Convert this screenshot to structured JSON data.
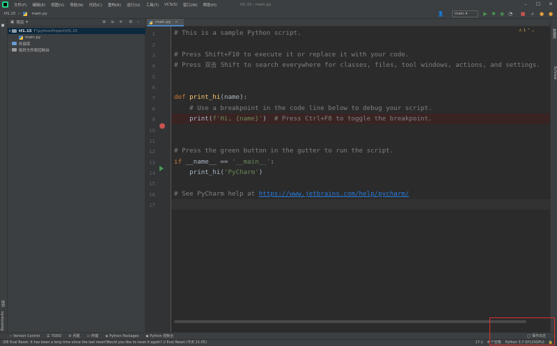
{
  "window": {
    "title": "tf1.15 - main.py"
  },
  "menu": [
    "文件(F)",
    "编辑(E)",
    "视图(V)",
    "导航(N)",
    "代码(C)",
    "重构(R)",
    "运行(U)",
    "工具(T)",
    "VCS(S)",
    "窗口(W)",
    "帮助(H)"
  ],
  "breadcrumb": {
    "project": "tf1.15",
    "file": "main.py"
  },
  "toolbar": {
    "run_config": "main"
  },
  "project_panel": {
    "title": "项目",
    "root_name": "tf1.15",
    "root_path": "F:\\pythonProject\\tf1.15",
    "file": "main.py",
    "external_libs": "外部库",
    "scratches": "临时文件和控制台"
  },
  "editor": {
    "tab": "main.py",
    "inspections": "1",
    "lines": [
      "1",
      "2",
      "3",
      "4",
      "5",
      "6",
      "7",
      "8",
      "9",
      "10",
      "11",
      "12",
      "13",
      "14",
      "15",
      "16",
      "17"
    ],
    "code": {
      "l1": "# This is a sample Python script.",
      "l3": "# Press Shift+F10 to execute it or replace it with your code.",
      "l4a": "# Press ",
      "l4b": "双击",
      "l4c": " Shift to search everywhere for classes, files, tool windows, actions, and settings.",
      "l7_kw": "def ",
      "l7_fn": "print_hi",
      "l7_rest": "(name):",
      "l8": "    # Use a breakpoint in the code line below to debug your script.",
      "l9_a": "    print(",
      "l9_str": "f'Hi, {name}'",
      "l9_b": ")  ",
      "l9_cmt": "# Press Ctrl+F8 to toggle the breakpoint.",
      "l12": "# Press the green button in the gutter to run the script.",
      "l13_kw": "if ",
      "l13_a": "__name__ == ",
      "l13_str": "'__main__'",
      "l13_b": ":",
      "l14_a": "    print_hi(",
      "l14_str": "'PyCharm'",
      "l14_b": ")",
      "l16_cmt": "# See PyCharm help at ",
      "l16_url": "https://www.jetbrains.com/help/pycharm/"
    }
  },
  "left_stripe": {
    "structure": "结构",
    "bookmarks": "Bookmarks"
  },
  "right_stripe": {
    "database": "数据库",
    "sciview": "SciView"
  },
  "tool_windows": [
    "Version Control",
    "TODO",
    "问题",
    "终端",
    "Python Packages",
    "Python 控制台"
  ],
  "event_log": "事件日志",
  "status": {
    "message": "IDE Eval Reset: It has been a long time since the last reset!Would you like to reset it again? // Eval Reset (今天 21:05)",
    "position": "17:1",
    "indent": "4 个空格",
    "interpreter": "Python 3.7 (tf115GPU)"
  }
}
